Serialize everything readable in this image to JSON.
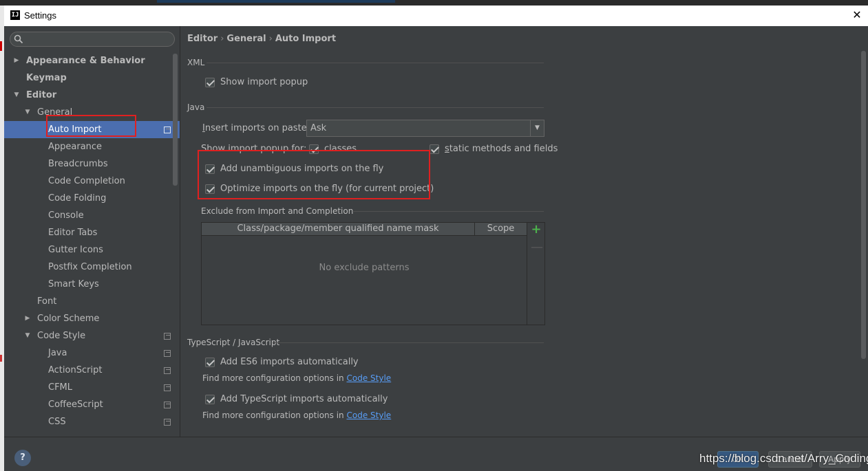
{
  "window": {
    "title": "Settings",
    "app_icon_text": "IJ",
    "close_symbol": "✕"
  },
  "search": {
    "placeholder": "",
    "icon": "search-icon"
  },
  "sidebar": {
    "items": [
      {
        "label": "Appearance & Behavior",
        "arrow": "▶"
      },
      {
        "label": "Keymap"
      },
      {
        "label": "Editor",
        "arrow": "▼"
      },
      {
        "label": "General",
        "arrow": "▼"
      },
      {
        "label": "Auto Import"
      },
      {
        "label": "Appearance"
      },
      {
        "label": "Breadcrumbs"
      },
      {
        "label": "Code Completion"
      },
      {
        "label": "Code Folding"
      },
      {
        "label": "Console"
      },
      {
        "label": "Editor Tabs"
      },
      {
        "label": "Gutter Icons"
      },
      {
        "label": "Postfix Completion"
      },
      {
        "label": "Smart Keys"
      },
      {
        "label": "Font"
      },
      {
        "label": "Color Scheme",
        "arrow": "▶"
      },
      {
        "label": "Code Style",
        "arrow": "▼"
      },
      {
        "label": "Java"
      },
      {
        "label": "ActionScript"
      },
      {
        "label": "CFML"
      },
      {
        "label": "CoffeeScript"
      },
      {
        "label": "CSS"
      }
    ]
  },
  "breadcrumb": {
    "editor": "Editor",
    "general": "General",
    "current": "Auto Import",
    "sep": "›"
  },
  "xml": {
    "title": "XML",
    "show_import_popup": {
      "label": "Show import popup",
      "checked": true
    }
  },
  "java": {
    "title": "Java",
    "insert_on_paste_label_pre": "I",
    "insert_on_paste_label_post": "nsert imports on paste:",
    "insert_on_paste_value": "Ask",
    "show_popup_for_label_pre": "Show import popup for:",
    "classes": {
      "label": "classes",
      "checked": true
    },
    "static_methods": {
      "label_pre": "s",
      "label_post": "tatic methods and fields",
      "checked": true
    },
    "add_unambiguous": {
      "label": "Add unambiguous imports on the fly",
      "checked": true
    },
    "optimize_imports": {
      "label": "Optimize imports on the fly (for current project)",
      "checked": true
    }
  },
  "exclude": {
    "title": "Exclude from Import and Completion",
    "col_mask": "Class/package/member qualified name mask",
    "col_scope": "Scope",
    "empty_text": "No exclude patterns",
    "add_symbol": "+",
    "remove_symbol": "—"
  },
  "typescript": {
    "title": "TypeScript / JavaScript",
    "add_es6": {
      "label": "Add ES6 imports automatically",
      "checked": true
    },
    "hint1_text": "Find more configuration options in ",
    "hint1_link": "Code Style",
    "add_ts": {
      "label": "Add TypeScript imports automatically",
      "checked": true
    },
    "hint2_text": "Find more configuration options in ",
    "hint2_link": "Code Style"
  },
  "footer": {
    "help": "?",
    "ok": "OK",
    "cancel": "Cancel",
    "apply": "Apply",
    "watermark": "https://blog.csdn.net/Arry_Coding"
  },
  "colors": {
    "selection": "#4b6eaf",
    "highlight_box": "#e02020",
    "link": "#589df6"
  }
}
